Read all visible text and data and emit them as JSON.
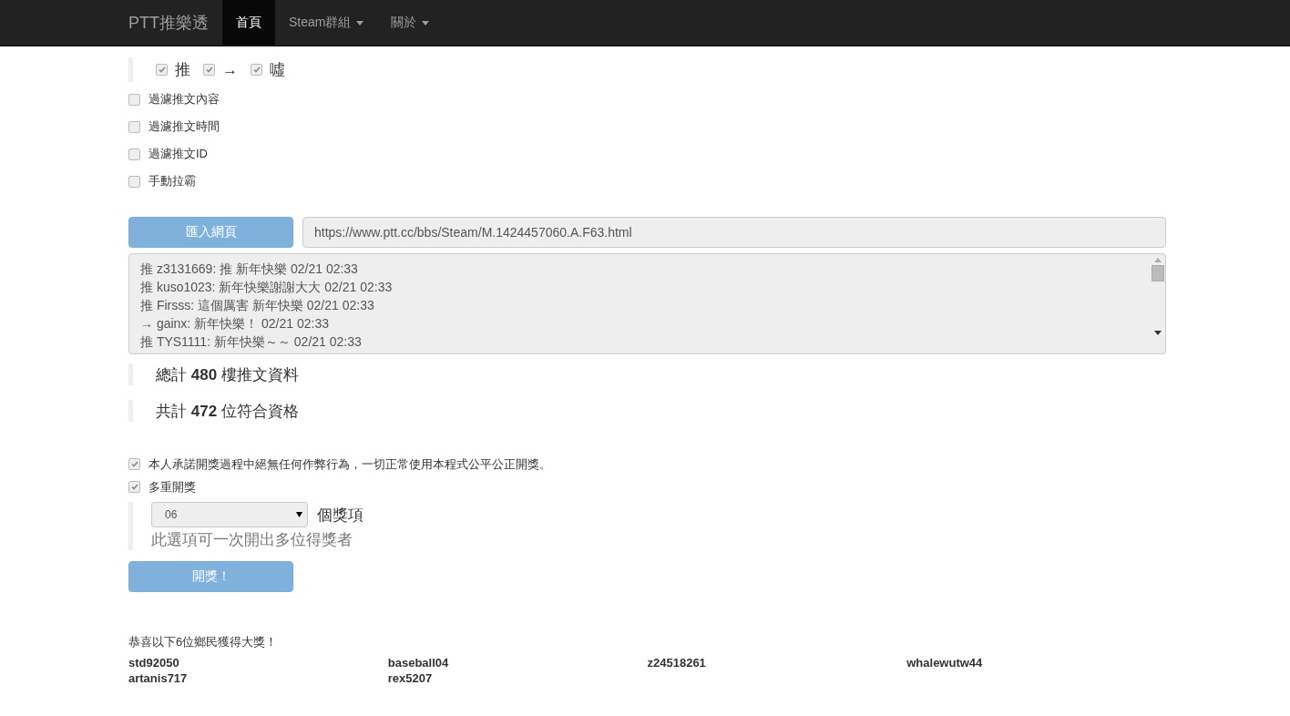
{
  "navbar": {
    "brand": "PTT推樂透",
    "items": [
      {
        "label": "首頁",
        "selected": true,
        "dropdown": false
      },
      {
        "label": "Steam群組",
        "selected": false,
        "dropdown": true
      },
      {
        "label": "關於",
        "selected": false,
        "dropdown": true
      }
    ]
  },
  "push_types": [
    {
      "label": "推",
      "checked": true
    },
    {
      "label": "→",
      "checked": true
    },
    {
      "label": "噓",
      "checked": true
    }
  ],
  "filters": [
    {
      "label": "過濾推文內容",
      "checked": false
    },
    {
      "label": "過濾推文時間",
      "checked": false
    },
    {
      "label": "過濾推文ID",
      "checked": false
    },
    {
      "label": "手動拉霸",
      "checked": false
    }
  ],
  "import": {
    "button": "匯入網頁",
    "url": "https://www.ptt.cc/bbs/Steam/M.1424457060.A.F63.html"
  },
  "comments": [
    "推 z3131669: 推 新年快樂 02/21 02:33",
    "推 kuso1023: 新年快樂謝謝大大 02/21 02:33",
    "推 Firsss: 這個厲害 新年快樂 02/21 02:33",
    "→ gainx: 新年快樂！ 02/21 02:33",
    "推 TYS1111: 新年快樂～～ 02/21 02:33"
  ],
  "stats": [
    "總計 **480** 樓推文資料",
    "共計 **472** 位符合資格"
  ],
  "options": [
    {
      "label": "本人承諾開獎過程中絕無任何作弊行為，一切正常使用本程式公平公正開獎。",
      "checked": true
    },
    {
      "label": "多重開獎",
      "checked": true
    }
  ],
  "prize_count": {
    "value": "06",
    "unit": "個獎項",
    "hint": "此選項可一次開出多位得獎者"
  },
  "draw_button": "開獎！",
  "result": {
    "message": "恭喜以下6位鄉民獲得大獎！",
    "winners": [
      "std92050",
      "baseball04",
      "z24518261",
      "whalewutw44",
      "artanis717",
      "rex5207"
    ]
  }
}
